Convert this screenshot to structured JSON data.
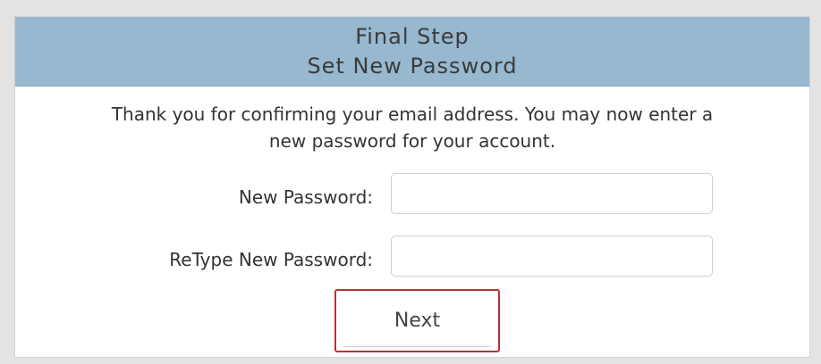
{
  "header": {
    "step": "Final Step",
    "title": "Set New Password"
  },
  "intro": {
    "line1": "Thank you for confirming your email address. You may now enter a",
    "line2": "new password for your account."
  },
  "form": {
    "new_password_label": "New Password:",
    "new_password_value": "",
    "retype_label": "ReType New Password:",
    "retype_value": "",
    "next_label": "Next"
  },
  "colors": {
    "header_bg": "#97b8cf",
    "button_border": "#b7323b"
  }
}
